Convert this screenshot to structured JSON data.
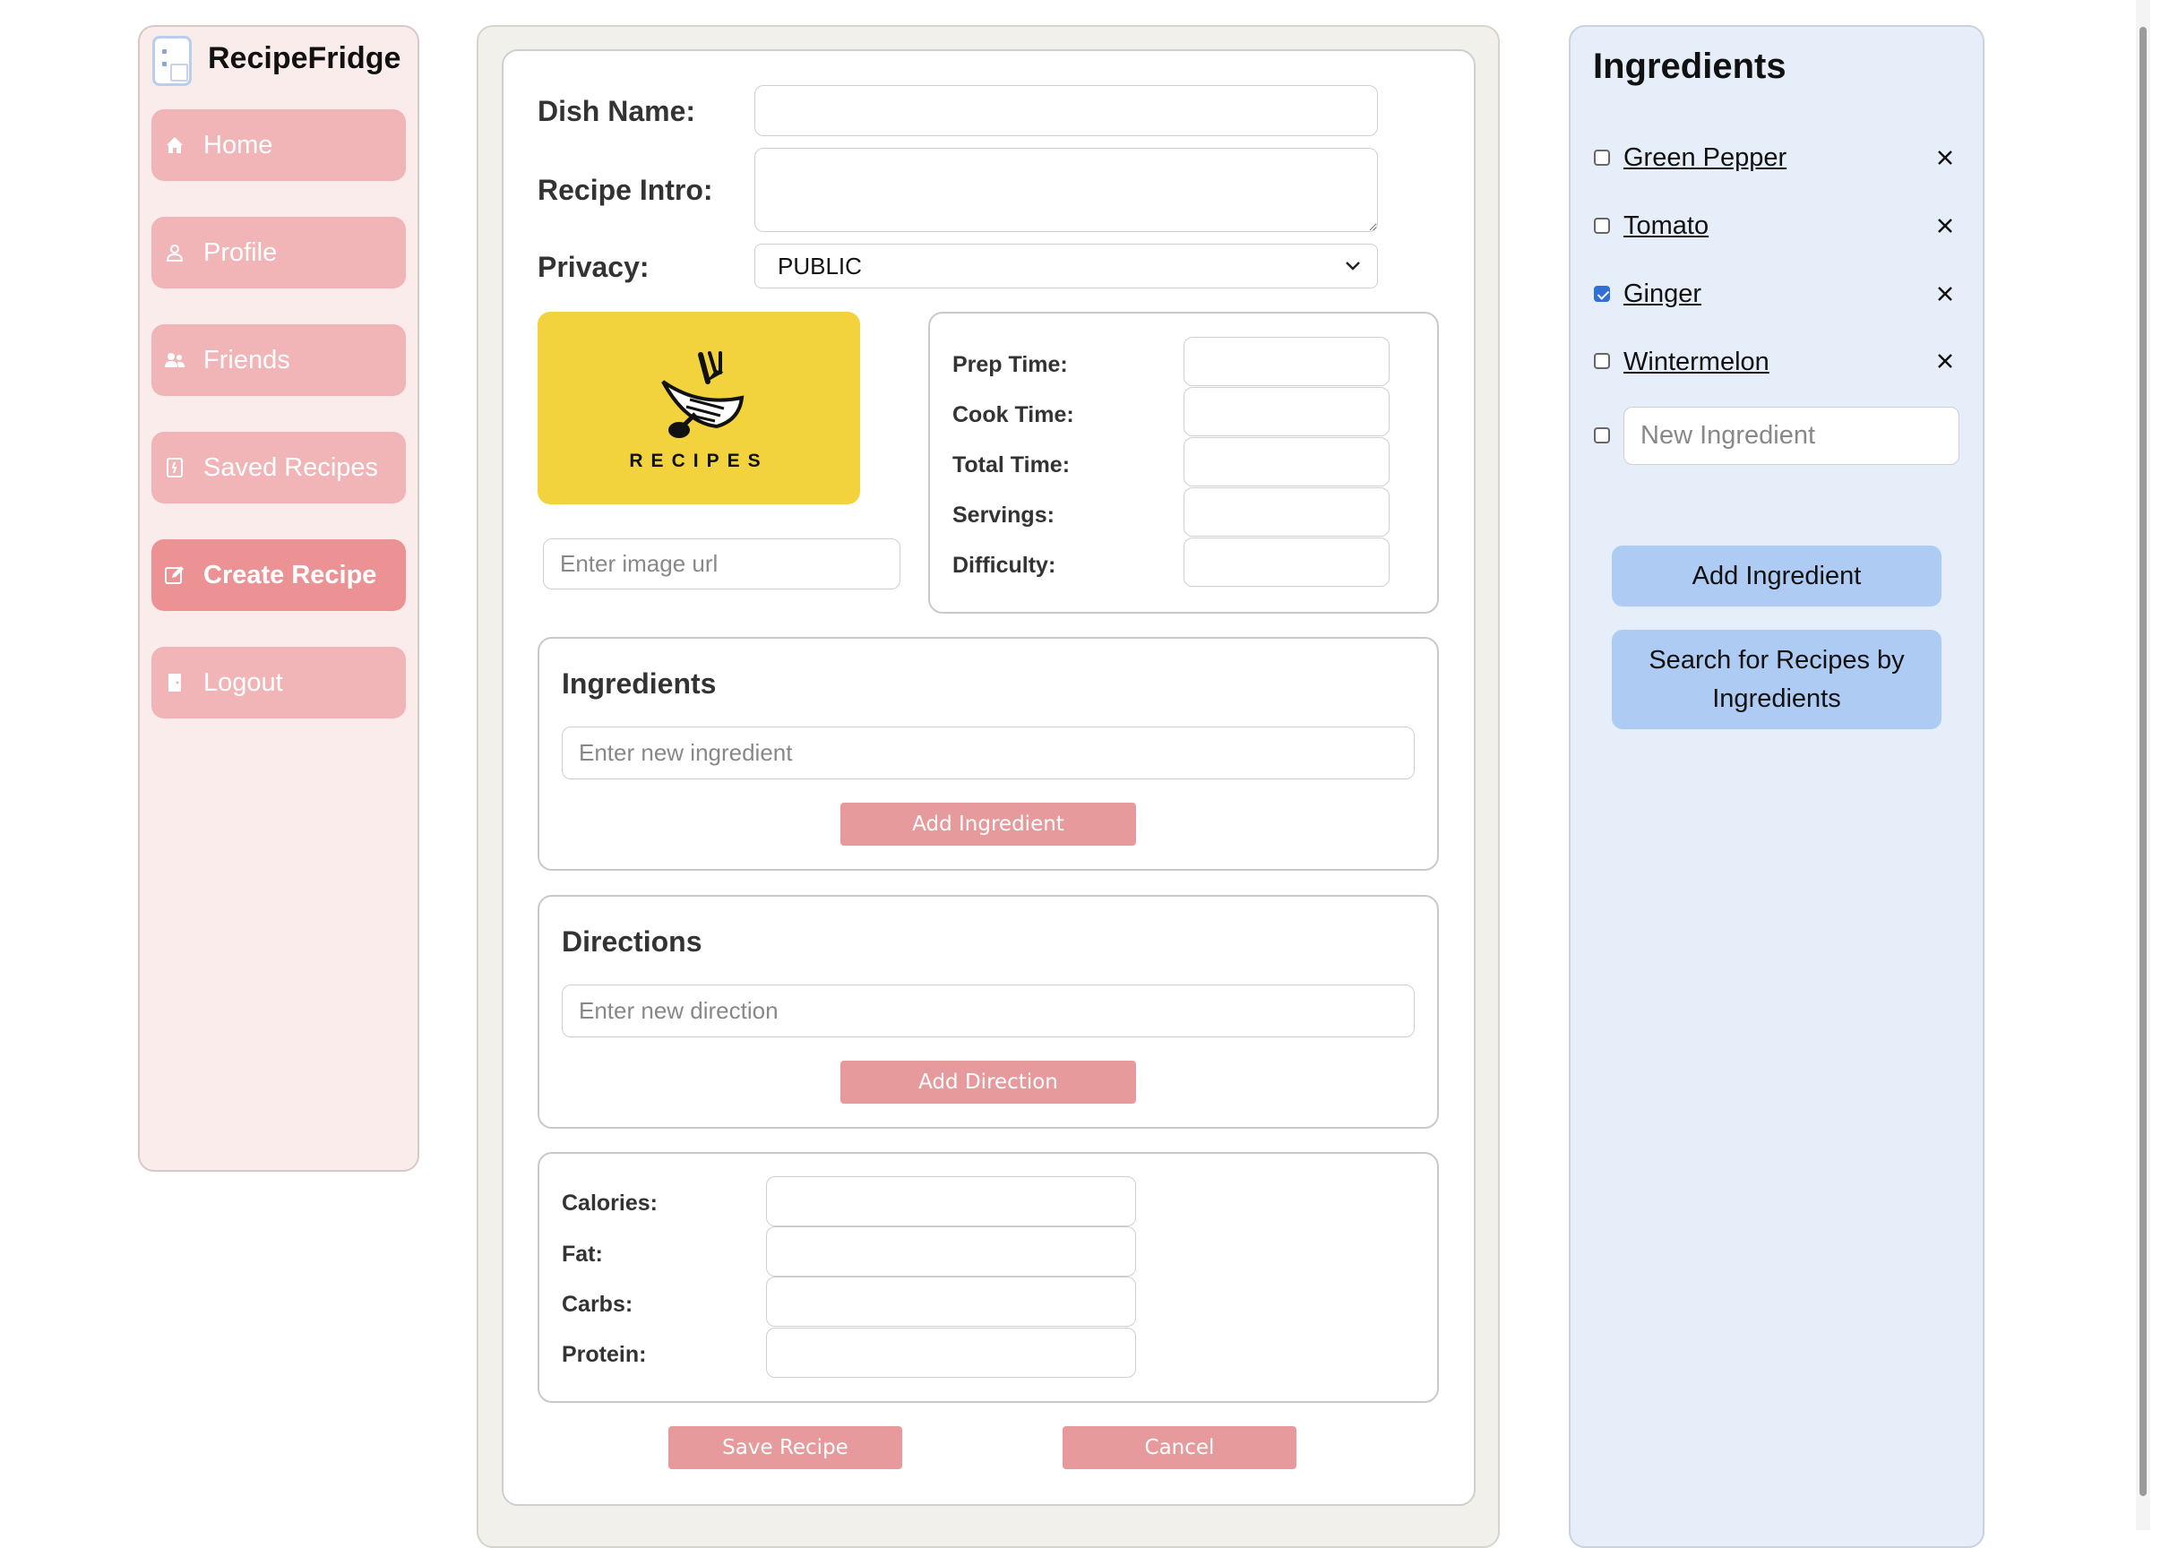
{
  "app": {
    "name": "RecipeFridge"
  },
  "sidebar": {
    "items": [
      {
        "label": "Home",
        "icon": "home-icon",
        "active": false
      },
      {
        "label": "Profile",
        "icon": "user-icon",
        "active": false
      },
      {
        "label": "Friends",
        "icon": "users-icon",
        "active": false
      },
      {
        "label": "Saved Recipes",
        "icon": "bookmark-icon",
        "active": false
      },
      {
        "label": "Create Recipe",
        "icon": "edit-icon",
        "active": true
      },
      {
        "label": "Logout",
        "icon": "door-icon",
        "active": false
      }
    ]
  },
  "form": {
    "dish_name_label": "Dish Name:",
    "dish_name_value": "",
    "intro_label": "Recipe Intro:",
    "intro_value": "",
    "privacy_label": "Privacy:",
    "privacy_value": "PUBLIC",
    "image_caption": "RECIPES",
    "image_url_placeholder": "Enter image url",
    "details": {
      "prep_label": "Prep Time:",
      "cook_label": "Cook Time:",
      "total_label": "Total Time:",
      "servings_label": "Servings:",
      "difficulty_label": "Difficulty:"
    },
    "ingredients": {
      "title": "Ingredients",
      "placeholder": "Enter new ingredient",
      "button": "Add Ingredient"
    },
    "directions": {
      "title": "Directions",
      "placeholder": "Enter new direction",
      "button": "Add Direction"
    },
    "nutrition": {
      "calories_label": "Calories:",
      "fat_label": "Fat:",
      "carbs_label": "Carbs:",
      "protein_label": "Protein:"
    },
    "save_button": "Save Recipe",
    "cancel_button": "Cancel"
  },
  "right_panel": {
    "title": "Ingredients",
    "items": [
      {
        "name": "Green Pepper",
        "checked": false
      },
      {
        "name": "Tomato",
        "checked": false
      },
      {
        "name": "Ginger",
        "checked": true
      },
      {
        "name": "Wintermelon",
        "checked": false
      }
    ],
    "new_placeholder": "New Ingredient",
    "add_button": "Add Ingredient",
    "search_button_line1": "Search for Recipes by",
    "search_button_line2": "Ingredients"
  },
  "colors": {
    "sidebar_bg": "#fbecec",
    "nav_item": "#f1b5b8",
    "nav_active": "#ec9194",
    "pink_button": "#e79a9c",
    "right_panel_bg": "#e5eef9",
    "blue_button": "#aecbf4",
    "image_yellow": "#f2d33d"
  }
}
